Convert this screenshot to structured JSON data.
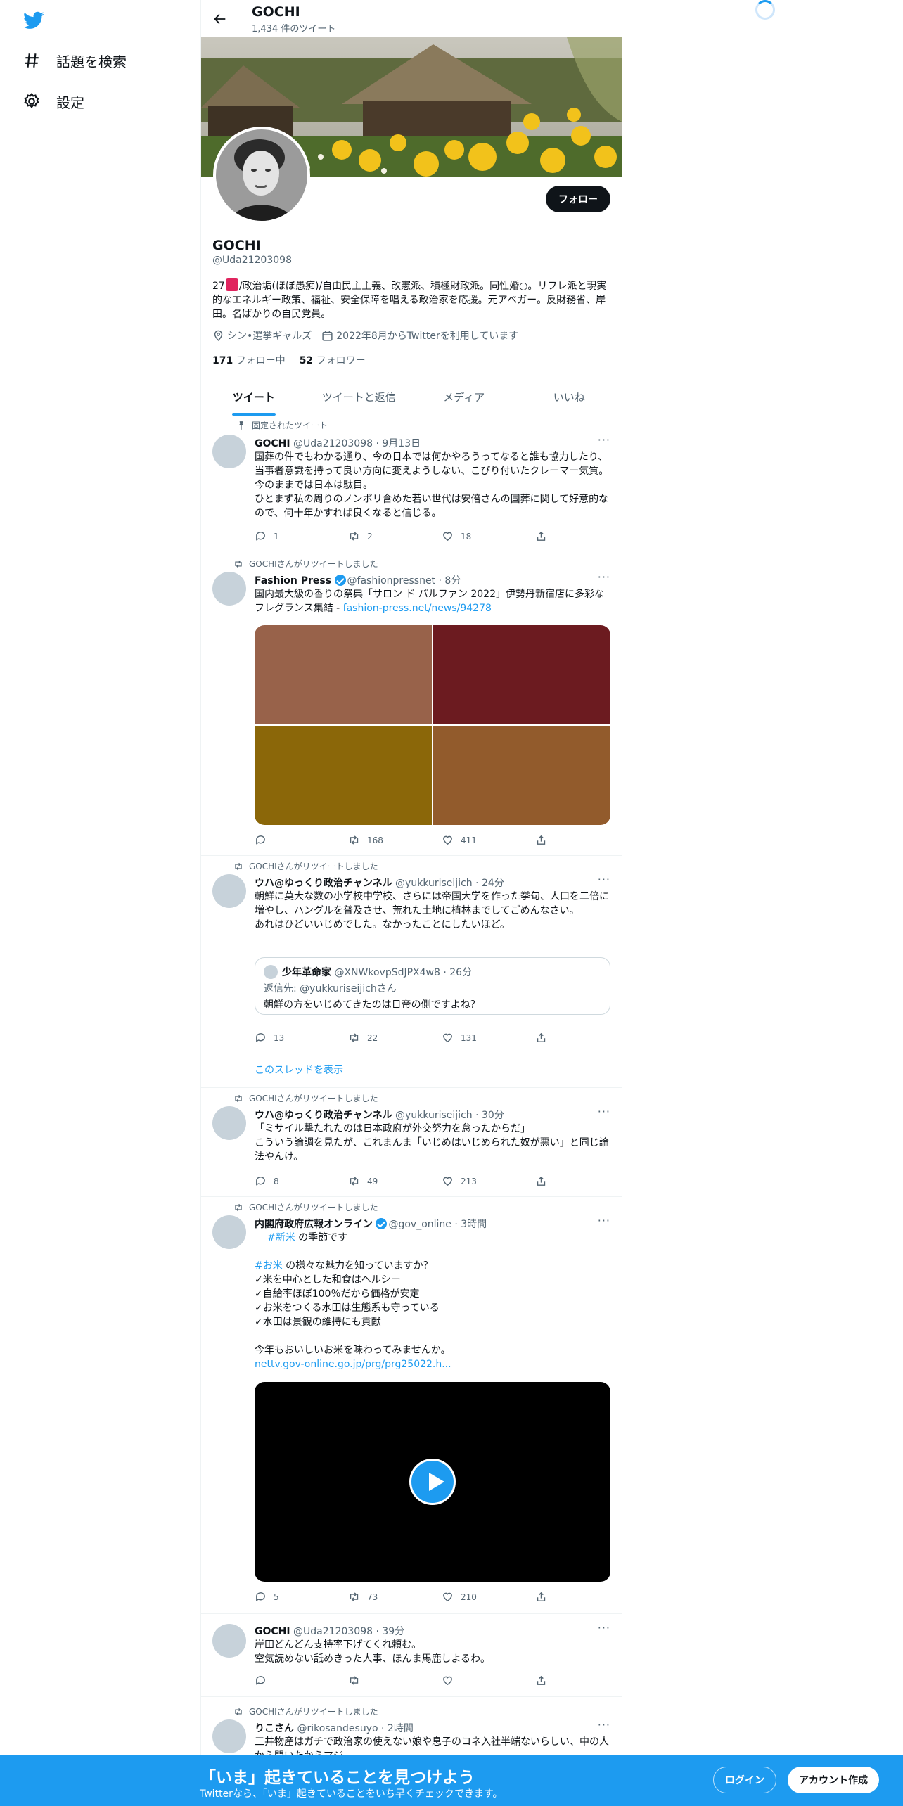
{
  "nav": {
    "explore_label": "話題を検索",
    "settings_label": "設定"
  },
  "header": {
    "name": "GOCHI",
    "tweet_count": "1,434 件のツイート"
  },
  "profile": {
    "name": "GOCHI",
    "handle": "@Uda21203098",
    "follow_label": "フォロー",
    "bio_pre": "27",
    "bio_post": "/政治垢(ほぼ愚痴)/自由民主主義、改憲派、積極財政派。同性婚○。リフレ派と現実的なエネルギー政策、福祉、安全保障を唱える政治家を応援。元アベガー。反財務省、岸田。名ばかりの自民党員。",
    "location": "シン•選挙ギャルズ",
    "joined": "2022年8月からTwitterを利用しています",
    "following_count": "171",
    "following_label": "フォロー中",
    "followers_count": "52",
    "followers_label": "フォロワー"
  },
  "tabs": [
    "ツイート",
    "ツイートと返信",
    "メディア",
    "いいね"
  ],
  "tweets": [
    {
      "context": "固定されたツイート",
      "name": "GOCHI",
      "handle": "@Uda21203098",
      "time": "9月13日",
      "text": "国葬の件でもわかる通り、今の日本では何かやろうってなると誰も協力したり、当事者意識を持って良い方向に変えようしない、こびり付いたクレーマー気質。今のままでは日本は駄目。\nひとまず私の周りのノンポリ含めた若い世代は安倍さんの国葬に関して好意的なので、何十年かすれば良くなると信じる。",
      "replies": "1",
      "retweets": "2",
      "likes": "18"
    },
    {
      "context": "GOCHIさんがリツイートしました",
      "name": "Fashion Press",
      "handle": "@fashionpressnet",
      "time": "8分",
      "text": "国内最大級の香りの祭典「サロン ド パルファン 2022」伊勢丹新宿店に多彩なフレグランス集結 - ",
      "link": "fashion-press.net/news/94278",
      "replies": "",
      "retweets": "168",
      "likes": "411"
    },
    {
      "context": "GOCHIさんがリツイートしました",
      "name": "ウハ@ゆっくり政治チャンネル",
      "handle": "@yukkuriseijich",
      "time": "24分",
      "text": "朝鮮に莫大な数の小学校中学校、さらには帝国大学を作った挙句、人口を二倍に増やし、ハングルを普及させ、荒れた土地に植林までしてごめんなさい。\nあれはひどいいじめでした。なかったことにしたいほど。",
      "quote_name": "少年革命家",
      "quote_handle": "@XNWkovpSdJPX4w8",
      "quote_time": "26分",
      "quote_reply": "返信先: @yukkuriseijichさん",
      "quote_text": "朝鮮の方をいじめてきたのは日帝の側ですよね？",
      "show_thread": "このスレッドを表示",
      "replies": "13",
      "retweets": "22",
      "likes": "131"
    },
    {
      "context": "GOCHIさんがリツイートしました",
      "name": "ウハ@ゆっくり政治チャンネル",
      "handle": "@yukkuriseijich",
      "time": "30分",
      "text": "「ミサイル撃たれたのは日本政府が外交努力を怠ったからだ」\nこういう論調を見たが、これまんま「いじめはいじめられた奴が悪い」と同じ論法やんけ。",
      "replies": "8",
      "retweets": "49",
      "likes": "213"
    },
    {
      "context": "GOCHIさんがリツイートしました",
      "name": "内閣府政府広報オンライン",
      "handle": "@gov_online",
      "time": "3時間",
      "hashtag1": "#新米",
      "line1_post": " の季節です",
      "hashtag2": "#お米",
      "line2_post": " の様々な魅力を知っていますか？",
      "body": "✓米を中心とした和食はヘルシー\n✓自給率ほぼ100％だから価格が安定\n✓お米をつくる水田は生態系も守っている\n✓水田は景観の維持にも貢献\n\n今年もおいしいお米を味わってみませんか。",
      "link": "nettv.gov-online.go.jp/prg/prg25022.h...",
      "replies": "5",
      "retweets": "73",
      "likes": "210"
    },
    {
      "name": "GOCHI",
      "handle": "@Uda21203098",
      "time": "39分",
      "text": "岸田どんどん支持率下げてくれ頼む。\n空気読めない舐めきった人事、ほんま馬鹿しよるわ。",
      "replies": "",
      "retweets": "",
      "likes": ""
    },
    {
      "context": "GOCHIさんがリツイートしました",
      "name": "りこさん",
      "handle": "@rikosandesuyo",
      "time": "2時間",
      "text": "三井物産はガチで政治家の使えない娘や息子のコネ入社半端ないらしい、中の人から聞いたからマジ"
    }
  ],
  "image_colors": [
    "#98624a",
    "#6c1b20",
    "#8b6709",
    "#925b2c"
  ],
  "bottom": {
    "title": "「いま」起きていることを見つけよう",
    "subtitle": "Twitterなら、「いま」起きていることをいち早くチェックできます。",
    "login": "ログイン",
    "signup": "アカウント作成"
  },
  "colors": {
    "accent": "#1d9bf0",
    "text": "#0f1419",
    "muted": "#536471"
  }
}
